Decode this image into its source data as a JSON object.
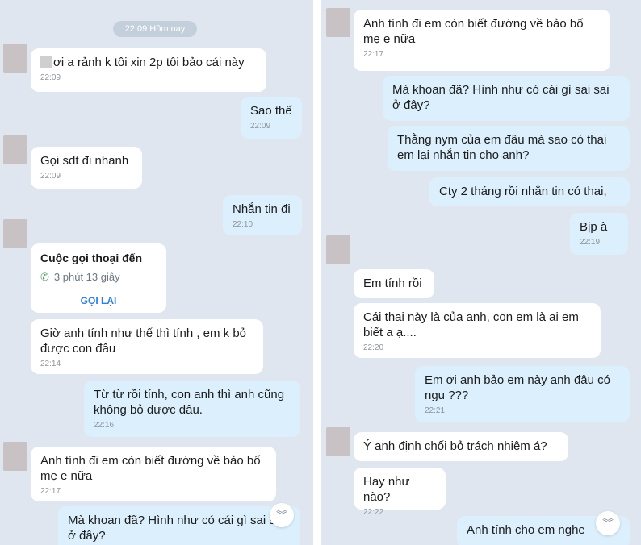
{
  "left": {
    "date_pill": "22:09 Hôm nay",
    "messages": [
      {
        "text": "ơi a rảnh k tôi xin 2p tôi bảo cái này",
        "time": "22:09"
      },
      {
        "text": "Sao thế",
        "time": "22:09"
      },
      {
        "text": "Gọi sdt đi nhanh",
        "time": "22:09"
      },
      {
        "text": "Nhắn tin đi",
        "time": "22:10"
      },
      {
        "text": "Giờ anh tính như thế thì tính , em k bỏ được con đâu",
        "time": "22:14"
      },
      {
        "text": "Từ từ rồi tính, con anh thì anh cũng không bỏ được đâu.",
        "time": "22:16"
      },
      {
        "text": "Anh tính đi em còn biết đường về bảo bố mẹ e nữa",
        "time": "22:17"
      },
      {
        "text": "Mà khoan đã? Hình như có cái gì sai sai ở đây?",
        "time": ""
      }
    ],
    "call": {
      "title": "Cuộc gọi thoại đến",
      "duration": "3 phút 13 giây",
      "callback": "GỌI LẠI"
    }
  },
  "right": {
    "messages": [
      {
        "text": "Anh tính đi em còn biết đường về bảo bố mẹ e nữa",
        "time": "22:17"
      },
      {
        "text": "Mà khoan đã? Hình như có cái gì sai sai ở đây?",
        "time": ""
      },
      {
        "text": "Thằng nym của em đâu mà sao có thai em lại nhắn tin cho anh?",
        "time": ""
      },
      {
        "text": "Cty 2 tháng rồi nhắn tin có thai,",
        "time": ""
      },
      {
        "text": "Bịp à",
        "time": "22:19"
      },
      {
        "text": "Em tính rồi",
        "time": ""
      },
      {
        "text": "Cái thai này là của anh, con em là ai em biết a ạ....",
        "time": "22:20"
      },
      {
        "text": "Em ơi anh bảo em này anh đâu có ngu ???",
        "time": "22:21"
      },
      {
        "text": "Ý anh định chối bỏ trách nhiệm á?",
        "time": ""
      },
      {
        "text": "Hay như nào?",
        "time": "22:22"
      },
      {
        "text": "Anh tính cho em nghe",
        "time": ""
      }
    ]
  },
  "icons": {
    "scroll_down": "chevron-double-down-icon",
    "phone": "phone-incoming-icon"
  },
  "colors": {
    "panel_bg": "#dfe6ef",
    "incoming_bubble": "#ffffff",
    "outgoing_bubble": "#dbeffd",
    "accent": "#2f7fe0"
  }
}
